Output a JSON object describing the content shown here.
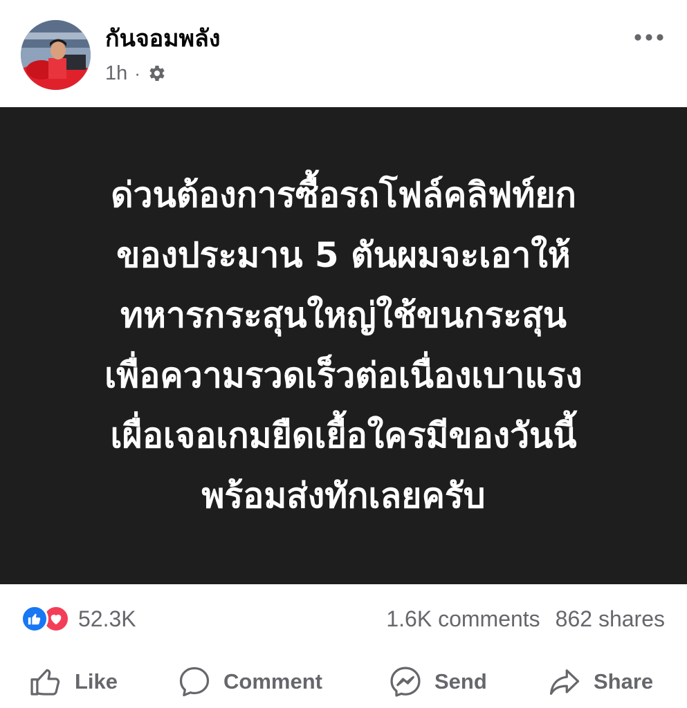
{
  "author": {
    "name": "กันจอมพลัง",
    "time": "1h",
    "separator": "·",
    "audience_icon": "gear-icon"
  },
  "post": {
    "background": "#1e1e1e",
    "lines": [
      "ด่วนต้องการซื้อรถโฟล์คลิฟท์ยก",
      "ของประมาน 5 ตันผมจะเอาให้",
      "ทหารกระสุนใหญ่ใช้ขนกระสุน",
      "เพื่อความรวดเร็วต่อเนื่องเบาแรง",
      "เผื่อเจอเกมยืดเยื้อใครมีของวันนี้",
      "พร้อมส่งทักเลยครับ"
    ]
  },
  "stats": {
    "reactions": "52.3K",
    "reaction_icons": [
      "like-icon",
      "love-icon"
    ],
    "comments": "1.6K comments",
    "shares": "862 shares"
  },
  "actions": {
    "like": "Like",
    "comment": "Comment",
    "send": "Send",
    "share": "Share"
  },
  "colors": {
    "like_blue": "#1877f2",
    "love_red": "#f33e58",
    "secondary_text": "#65676b"
  }
}
